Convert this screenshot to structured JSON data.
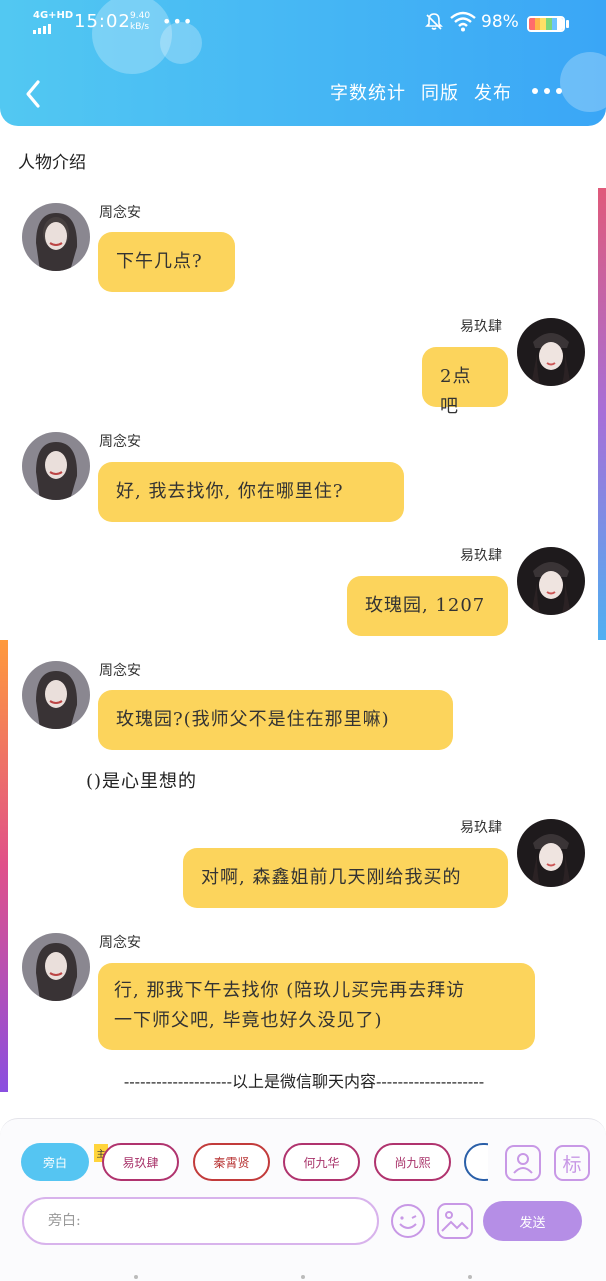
{
  "status_bar": {
    "network": "4G+HD",
    "time": "15:02",
    "speed_value": "9.40",
    "speed_unit": "kB/s",
    "overflow": "•••",
    "battery": "98%"
  },
  "header": {
    "buttons": [
      "字数统计",
      "同版",
      "发布"
    ]
  },
  "section_title": "人物介绍",
  "messages": [
    {
      "side": "left",
      "name": "周念安",
      "text": "下午几点?"
    },
    {
      "side": "right",
      "name": "易玖肆",
      "text": "2点吧"
    },
    {
      "side": "left",
      "name": "周念安",
      "text": "好, 我去找你, 你在哪里住?"
    },
    {
      "side": "right",
      "name": "易玖肆",
      "text": "玫瑰园, 1207"
    },
    {
      "side": "left",
      "name": "周念安",
      "text": "玫瑰园?(我师父不是住在那里嘛)"
    },
    {
      "side": "right",
      "name": "易玖肆",
      "text": "对啊, 森鑫姐前几天刚给我买的"
    },
    {
      "side": "left",
      "name": "周念安",
      "text_lines": [
        "行, 那我下午去找你 (陪玖儿买完再去拜访",
        "一下师父吧, 毕竟也好久没见了)"
      ]
    }
  ],
  "aside_note": "()是心里想的",
  "divider": "--------------------以上是微信聊天内容--------------------",
  "composer": {
    "roles": [
      "旁白",
      "易玖肆",
      "秦霄贤",
      "何九华",
      "尚九熙"
    ],
    "role_badge": "主",
    "tool_label_mark": "标",
    "input_placeholder": "旁白:",
    "send_label": "发送"
  },
  "colors": {
    "header_start": "#52c8f2",
    "header_end": "#3aa6f6",
    "bubble": "#fcd45c",
    "send_button": "#b58ee6",
    "active_role": "#55c5f2"
  }
}
